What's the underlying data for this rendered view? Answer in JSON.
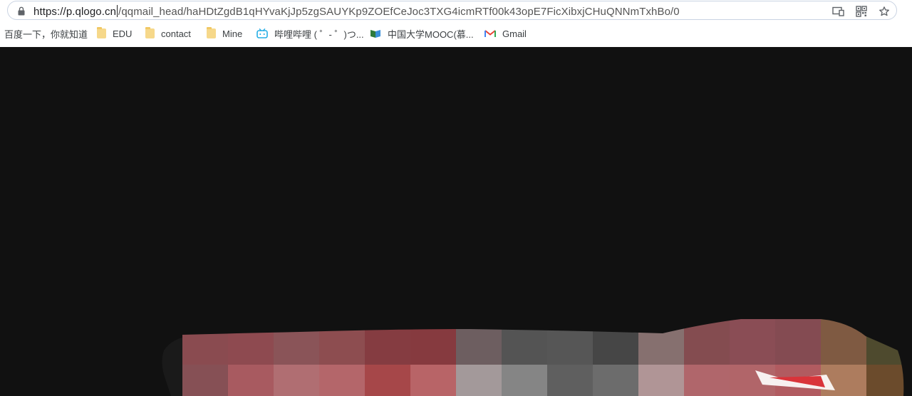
{
  "address_bar": {
    "host": "https://p.qlogo.cn",
    "path": "/qqmail_head/haHDtZgdB1qHYvaKjJp5zgSAUYKp9ZOEfCeJoc3TXG4icmRTf00k43opE7FicXibxjCHuQNNmTxhBo/0"
  },
  "icons": {
    "lock": "lock-icon",
    "cast": "cast-icon",
    "qr": "qr-code-icon",
    "star": "bookmark-star-icon"
  },
  "bookmarks": [
    {
      "label": "百度一下，你就知道",
      "icon": "none"
    },
    {
      "label": "EDU",
      "icon": "folder-icon"
    },
    {
      "label": "contact",
      "icon": "folder-icon"
    },
    {
      "label": "Mine",
      "icon": "folder-icon"
    },
    {
      "label": "哔哩哔哩 ( ゜- ゜)つ...",
      "icon": "bilibili-icon"
    },
    {
      "label": "中国大学MOOC(慕...",
      "icon": "mooc-icon"
    },
    {
      "label": "Gmail",
      "icon": "gmail-icon"
    }
  ],
  "colors": {
    "page_background": "#111111",
    "omnibox_border": "#c9d3e2",
    "folder": "#f6d88a"
  },
  "mosaic": {
    "rows": [
      [
        "#8a4b50",
        "#8e4a50",
        "#8a5458",
        "#8d4d50",
        "#853c41",
        "#863a3f",
        "#6d5e60",
        "#545454",
        "#565656",
        "#464646",
        "#86706f",
        "#844c50",
        "#8a4d55",
        "#844b52",
        "#7f5a42",
        "#4e4a2e"
      ],
      [
        "#865055",
        "#a85a60",
        "#b06e72",
        "#b4666a",
        "#a64749",
        "#b86467",
        "#a3999a",
        "#858585",
        "#5f5f5f",
        "#6c6c6c",
        "#b09596",
        "#b0666b",
        "#b16569",
        "#b15b60",
        "#ad7c5e",
        "#6b4b2c"
      ]
    ]
  }
}
